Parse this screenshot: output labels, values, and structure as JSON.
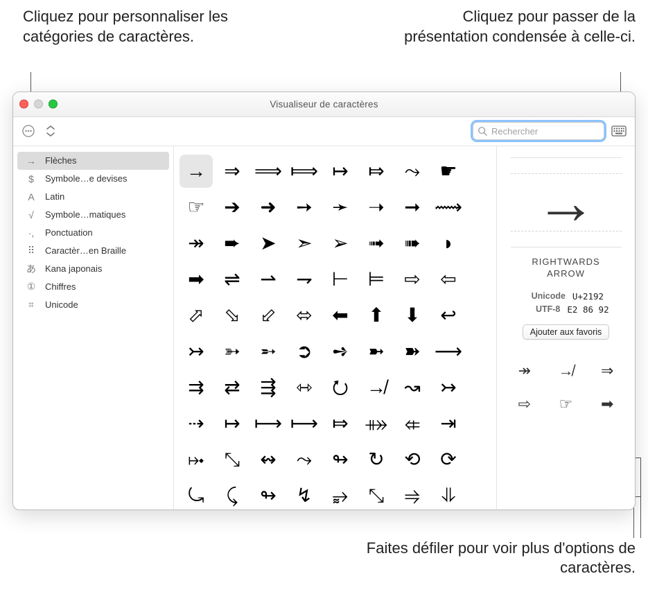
{
  "callouts": {
    "top_left": "Cliquez pour personnaliser les catégories de caractères.",
    "top_right": "Cliquez pour passer de la présentation condensée à celle-ci.",
    "bottom_right": "Faites défiler pour voir plus d'options de caractères."
  },
  "window": {
    "title": "Visualiseur de caractères"
  },
  "search": {
    "placeholder": "Rechercher"
  },
  "sidebar": {
    "items": [
      {
        "icon": "→",
        "label": "Flèches",
        "selected": true
      },
      {
        "icon": "$",
        "label": "Symbole…e devises"
      },
      {
        "icon": "A",
        "label": "Latin"
      },
      {
        "icon": "√",
        "label": "Symbole…matiques"
      },
      {
        "icon": "·,",
        "label": "Ponctuation"
      },
      {
        "icon": "⠿",
        "label": "Caractèr…en Braille"
      },
      {
        "icon": "あ",
        "label": "Kana japonais"
      },
      {
        "icon": "①",
        "label": "Chiffres"
      },
      {
        "icon": "⌗",
        "label": "Unicode"
      }
    ]
  },
  "grid": {
    "rows": [
      [
        "→",
        "⇒",
        "⟹",
        "⟾",
        "↦",
        "⤇",
        "⤳",
        "☛"
      ],
      [
        "☞",
        "➔",
        "➜",
        "➙",
        "➛",
        "➝",
        "➞",
        "⟿"
      ],
      [
        "↠",
        "➨",
        "➤",
        "➣",
        "➢",
        "➟",
        "➠",
        "◗"
      ],
      [
        "➡",
        "⇌",
        "⇀",
        "⇁",
        "⊢",
        "⊨",
        "⇨",
        "⇦"
      ],
      [
        "⬀",
        "⬂",
        "⬃",
        "⬄",
        "⬅",
        "⬆",
        "⬇",
        "↩"
      ],
      [
        "↣",
        "➳",
        "➵",
        "➲",
        "➺",
        "➼",
        "➽",
        "⟶"
      ],
      [
        "⇉",
        "⇄",
        "⇶",
        "⇿",
        "⭮",
        "↛",
        "↝",
        "↣"
      ],
      [
        "⇢",
        "↦",
        "⟼",
        "⟼",
        "⤇",
        "⤁",
        "⤂",
        "⇥"
      ],
      [
        "⤠",
        "⤡",
        "↭",
        "⤳",
        "↬",
        "↻",
        "⟲",
        "⟳"
      ],
      [
        "⤿",
        "⤹",
        "↬",
        "↯",
        "⥵",
        "⤡",
        "⥤",
        "⥥"
      ]
    ],
    "selected": [
      0,
      0
    ]
  },
  "detail": {
    "preview_char": "→",
    "name_line1": "RIGHTWARDS",
    "name_line2": "ARROW",
    "unicode_label": "Unicode",
    "unicode_value": "U+2192",
    "utf8_label": "UTF-8",
    "utf8_value": "E2 86 92",
    "favorite_button": "Ajouter aux favoris",
    "related": [
      "↠",
      "↛",
      "⇒",
      "⇨",
      "☞",
      "➡"
    ]
  }
}
